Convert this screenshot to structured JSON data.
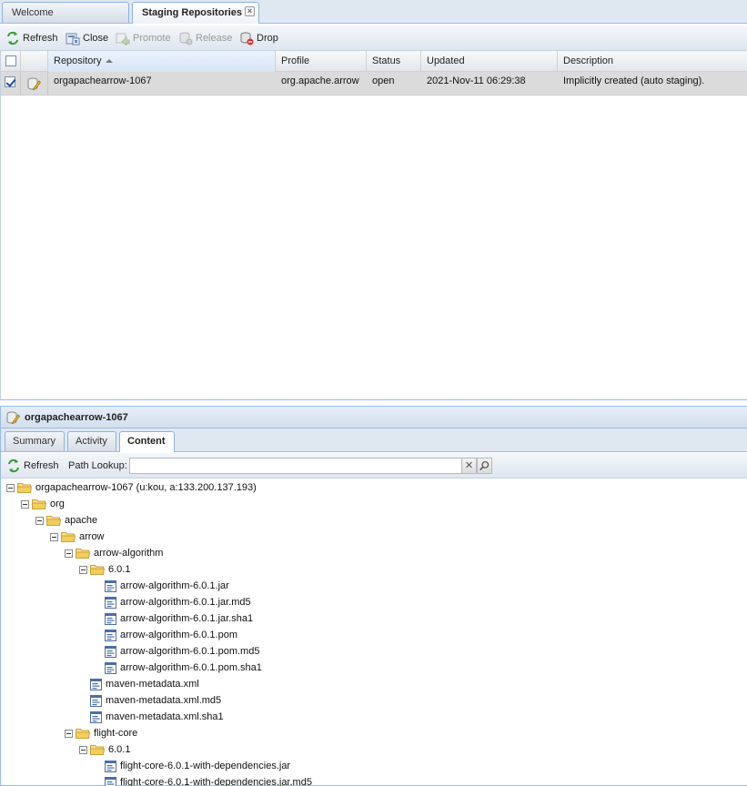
{
  "tabs": [
    {
      "label": "Welcome",
      "active": false
    },
    {
      "label": "Staging Repositories",
      "active": true
    }
  ],
  "toolbar": {
    "refresh": "Refresh",
    "close": "Close",
    "promote": "Promote",
    "release": "Release",
    "drop": "Drop"
  },
  "grid": {
    "columns": [
      "Repository",
      "Profile",
      "Status",
      "Updated",
      "Description"
    ],
    "sort": {
      "column": "Repository",
      "direction": "ascending"
    },
    "rows": [
      {
        "checked": true,
        "repository": "orgapachearrow-1067",
        "profile": "org.apache.arrow",
        "status": "open",
        "updated": "2021-Nov-11 06:29:38",
        "description": "Implicitly created (auto staging)."
      }
    ]
  },
  "detail": {
    "title": "orgapachearrow-1067",
    "tabs": [
      "Summary",
      "Activity",
      "Content"
    ],
    "active_tab": "Content",
    "content_toolbar": {
      "refresh": "Refresh",
      "path_lookup_label": "Path Lookup:",
      "path_lookup_value": ""
    }
  },
  "tree": [
    {
      "label": "orgapachearrow-1067 (u:kou, a:133.200.137.193)",
      "type": "folder",
      "depth": 0
    },
    {
      "label": "org",
      "type": "folder",
      "depth": 1
    },
    {
      "label": "apache",
      "type": "folder",
      "depth": 2
    },
    {
      "label": "arrow",
      "type": "folder",
      "depth": 3
    },
    {
      "label": "arrow-algorithm",
      "type": "folder",
      "depth": 4
    },
    {
      "label": "6.0.1",
      "type": "folder",
      "depth": 5
    },
    {
      "label": "arrow-algorithm-6.0.1.jar",
      "type": "file",
      "depth": 6
    },
    {
      "label": "arrow-algorithm-6.0.1.jar.md5",
      "type": "file",
      "depth": 6
    },
    {
      "label": "arrow-algorithm-6.0.1.jar.sha1",
      "type": "file",
      "depth": 6
    },
    {
      "label": "arrow-algorithm-6.0.1.pom",
      "type": "file",
      "depth": 6
    },
    {
      "label": "arrow-algorithm-6.0.1.pom.md5",
      "type": "file",
      "depth": 6
    },
    {
      "label": "arrow-algorithm-6.0.1.pom.sha1",
      "type": "file",
      "depth": 6
    },
    {
      "label": "maven-metadata.xml",
      "type": "file",
      "depth": 5
    },
    {
      "label": "maven-metadata.xml.md5",
      "type": "file",
      "depth": 5
    },
    {
      "label": "maven-metadata.xml.sha1",
      "type": "file",
      "depth": 5
    },
    {
      "label": "flight-core",
      "type": "folder",
      "depth": 4
    },
    {
      "label": "6.0.1",
      "type": "folder",
      "depth": 5
    },
    {
      "label": "flight-core-6.0.1-with-dependencies.jar",
      "type": "file",
      "depth": 6
    },
    {
      "label": "flight-core-6.0.1-with-dependencies.jar.md5",
      "type": "file",
      "depth": 6
    }
  ],
  "icons": {
    "refresh": "refresh-icon",
    "close": "close-repo-icon",
    "promote": "promote-icon",
    "release": "release-icon",
    "drop": "drop-icon",
    "repository": "staging-repository-icon",
    "folder": "folder-icon",
    "file": "file-icon"
  },
  "colors": {
    "accent_blue": "#99bbe8",
    "selected_row": "#dbdbdb",
    "title_text": "#15428b",
    "folder_yellow": "#f2cd5c",
    "refresh_green": "#3a9a3a",
    "drop_red": "#d9302a"
  }
}
